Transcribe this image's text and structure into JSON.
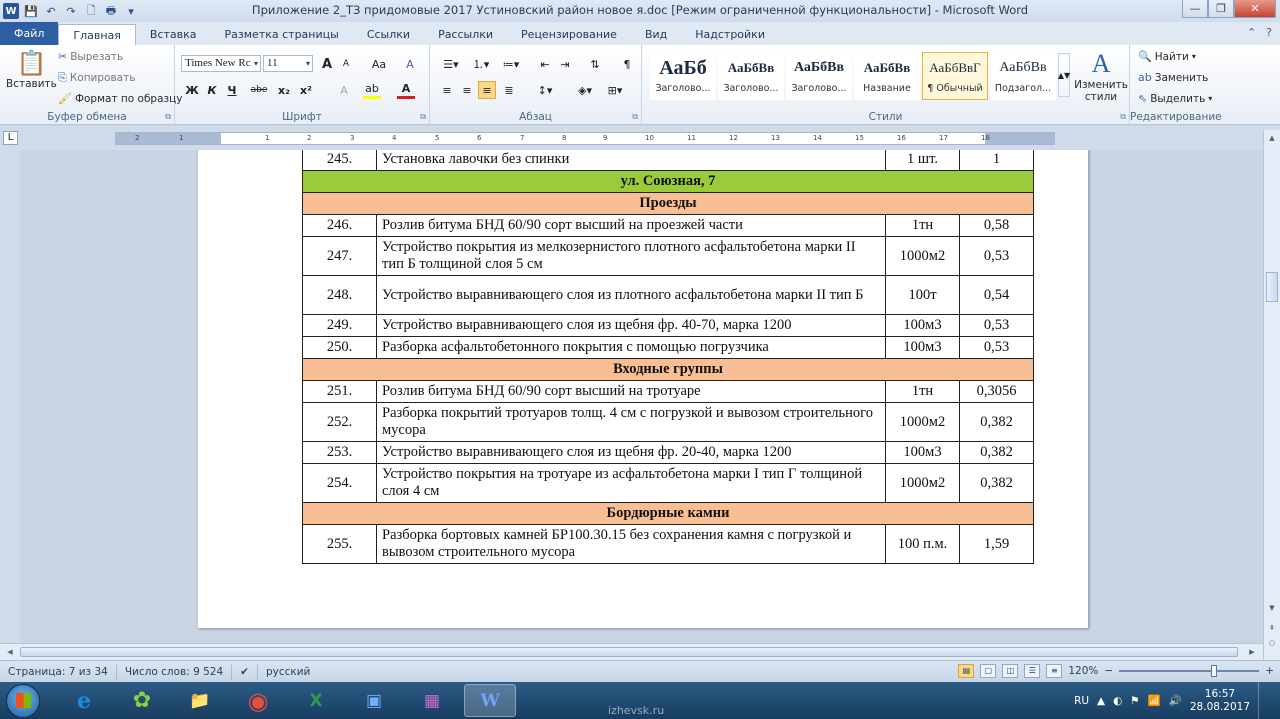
{
  "window": {
    "title": "Приложение 2_ТЗ придомовые 2017 Устиновский район новое я.doc [Режим ограниченной функциональности]  -  Microsoft Word",
    "qat": [
      "W",
      "💾",
      "↶",
      "↷",
      "🗋",
      "🖶",
      "▾"
    ],
    "controls": [
      "—",
      "❐",
      "✕"
    ]
  },
  "tabs": [
    "Файл",
    "Главная",
    "Вставка",
    "Разметка страницы",
    "Ссылки",
    "Рассылки",
    "Рецензирование",
    "Вид",
    "Надстройки"
  ],
  "ribbon": {
    "clipboard": {
      "label": "Буфер обмена",
      "paste": "Вставить",
      "cut": "Вырезать",
      "copy": "Копировать",
      "format_painter": "Формат по образцу"
    },
    "font": {
      "label": "Шрифт",
      "font_name": "Times New Rc",
      "font_size": "11",
      "bold": "Ж",
      "italic": "К",
      "underline": "Ч",
      "strike": "abe",
      "subscript": "x₂",
      "superscript": "x²",
      "grow": "A",
      "shrink": "A",
      "case": "Aa",
      "clear": "A"
    },
    "paragraph": {
      "label": "Абзац"
    },
    "styles": {
      "label": "Стили",
      "items": [
        {
          "sample": "АаБб",
          "name": "Заголово..."
        },
        {
          "sample": "АаБбВв",
          "name": "Заголово..."
        },
        {
          "sample": "АаБбВв",
          "name": "Заголово..."
        },
        {
          "sample": "АаБбВв",
          "name": "Название"
        },
        {
          "sample": "АаБбВвГ",
          "name": "¶ Обычный"
        },
        {
          "sample": "АаБбВв",
          "name": "Подзагол..."
        }
      ],
      "change_styles": "Изменить стили"
    },
    "editing": {
      "label": "Редактирование",
      "find": "Найти",
      "replace": "Заменить",
      "select": "Выделить"
    }
  },
  "ruler": {
    "ticks": [
      "2",
      "1",
      "1",
      "2",
      "3",
      "4",
      "5",
      "6",
      "7",
      "8",
      "9",
      "10",
      "11",
      "12",
      "13",
      "14",
      "15",
      "16",
      "17",
      "18"
    ]
  },
  "table": {
    "rows": [
      {
        "kind": "item",
        "num": "245.",
        "desc": "Установка лавочки без спинки",
        "unit": "1 шт.",
        "qty": "1"
      },
      {
        "kind": "street",
        "text": "ул. Союзная, 7"
      },
      {
        "kind": "section",
        "text": "Проезды"
      },
      {
        "kind": "item",
        "num": "246.",
        "desc": "Розлив битума БНД 60/90 сорт высший на проезжей части",
        "unit": "1тн",
        "qty": "0,58"
      },
      {
        "kind": "item2",
        "num": "247.",
        "desc": "Устройство покрытия из мелкозернистого плотного асфальтобетона марки II тип Б толщиной слоя 5 см",
        "unit": "1000м2",
        "qty": "0,53"
      },
      {
        "kind": "item2",
        "num": "248.",
        "desc": "Устройство выравнивающего слоя из плотного асфальтобетона марки II тип Б",
        "unit": "100т",
        "qty": "0,54"
      },
      {
        "kind": "item",
        "num": "249.",
        "desc": "Устройство выравнивающего слоя из щебня фр. 40-70, марка 1200",
        "unit": "100м3",
        "qty": "0,53"
      },
      {
        "kind": "item",
        "num": "250.",
        "desc": "Разборка асфальтобетонного покрытия с помощью погрузчика",
        "unit": "100м3",
        "qty": "0,53"
      },
      {
        "kind": "section",
        "text": "Входные группы"
      },
      {
        "kind": "item",
        "num": "251.",
        "desc": "Розлив битума БНД 60/90 сорт высший на тротуаре",
        "unit": "1тн",
        "qty": "0,3056"
      },
      {
        "kind": "item2",
        "num": "252.",
        "desc": "Разборка покрытий тротуаров толщ. 4 см с погрузкой и вывозом строительного мусора",
        "unit": "1000м2",
        "qty": "0,382"
      },
      {
        "kind": "item",
        "num": "253.",
        "desc": "Устройство выравнивающего слоя из щебня фр. 20-40, марка 1200",
        "unit": "100м3",
        "qty": "0,382"
      },
      {
        "kind": "item2",
        "num": "254.",
        "desc": " Устройство покрытия на тротуаре из асфальтобетона марки I тип Г толщиной слоя 4 см",
        "unit": "1000м2",
        "qty": "0,382"
      },
      {
        "kind": "section",
        "text": "Бордюрные камни"
      },
      {
        "kind": "item2",
        "num": "255.",
        "desc": "Разборка бортовых камней БР100.30.15 без сохранения камня с погрузкой и вывозом строительного мусора",
        "unit": "100 п.м.",
        "qty": "1,59"
      }
    ]
  },
  "status": {
    "page": "Страница: 7 из 34",
    "words": "Число слов: 9 524",
    "language": "русский",
    "zoom": "120%",
    "zoom_minus": "−",
    "zoom_plus": "+"
  },
  "taskbar": {
    "apps": [
      "e",
      "✿",
      "📁",
      "◉",
      "X",
      "▣",
      "▦",
      "W"
    ],
    "lang": "RU",
    "time": "16:57",
    "date": "28.08.2017",
    "watermark": "izhevsk.ru"
  },
  "colors": {
    "street_row": "#9bcb3c",
    "section_row": "#f8bf94",
    "file_tab": "#2d5ea2"
  }
}
